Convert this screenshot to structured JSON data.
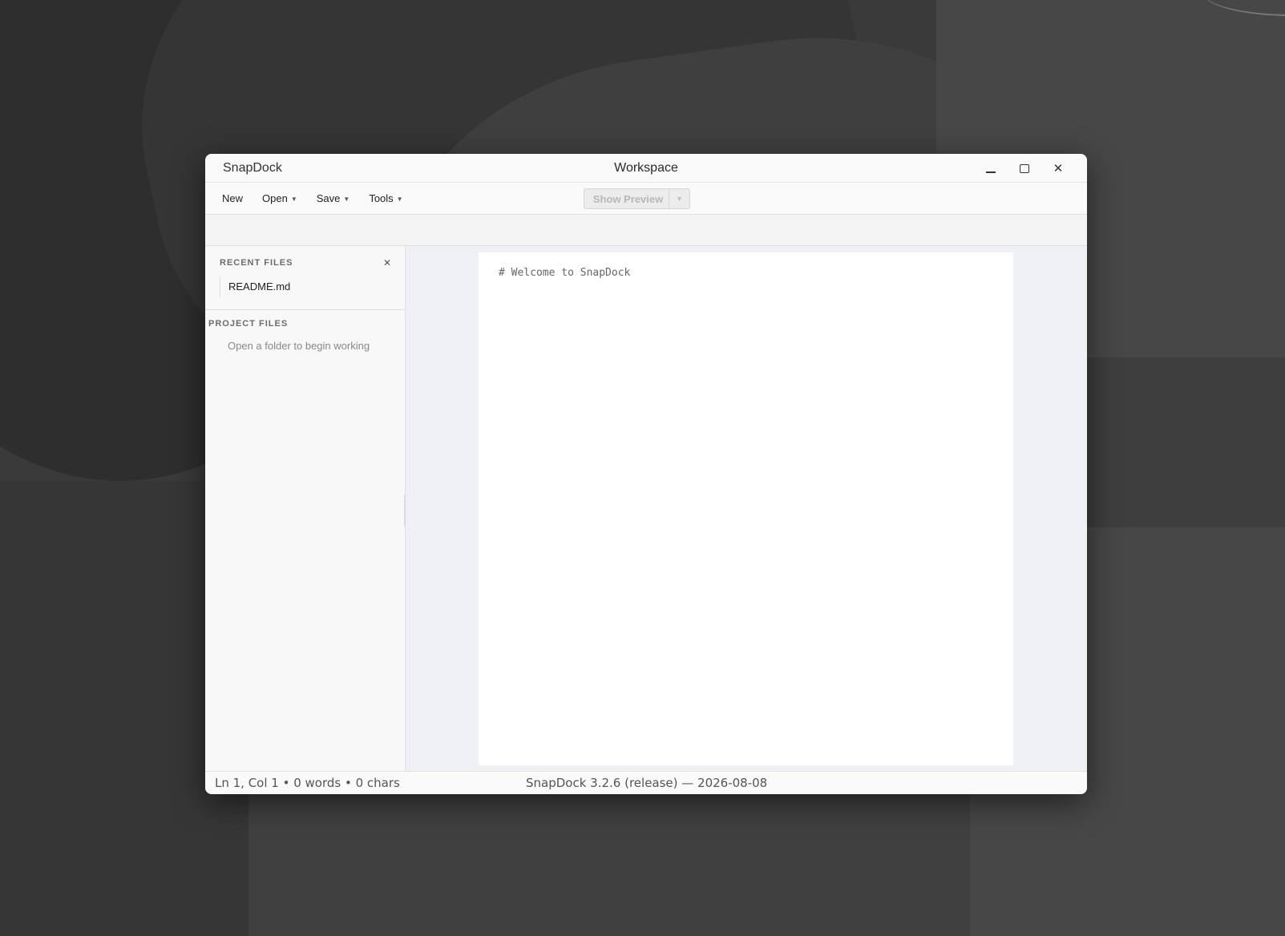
{
  "window": {
    "app_name": "SnapDock",
    "title": "Workspace"
  },
  "toolbar": {
    "new_label": "New",
    "open_label": "Open",
    "save_label": "Save",
    "tools_label": "Tools",
    "show_preview_label": "Show Preview",
    "show_preview_enabled": false
  },
  "sidebar": {
    "recent_files": {
      "heading": "RECENT FILES",
      "items": [
        {
          "name": "README.md"
        }
      ]
    },
    "project_files": {
      "heading": "PROJECT FILES",
      "empty_message": "Open a folder to begin working"
    }
  },
  "editor": {
    "content": "# Welcome to SnapDock"
  },
  "status": {
    "position": "Ln 1, Col 1 • 0 words • 0 chars",
    "version": "SnapDock 3.2.6 (release) — 2026-08-08"
  },
  "icons": {
    "minimize": "minimize-icon",
    "maximize": "maximize-icon",
    "close": "close-icon",
    "caret": "chevron-down-icon"
  },
  "colors": {
    "window_bg": "#fafafa",
    "editor_bg": "#eef0f3",
    "page_bg": "#ffffff",
    "desktop_bg": "#3a3a3a"
  }
}
